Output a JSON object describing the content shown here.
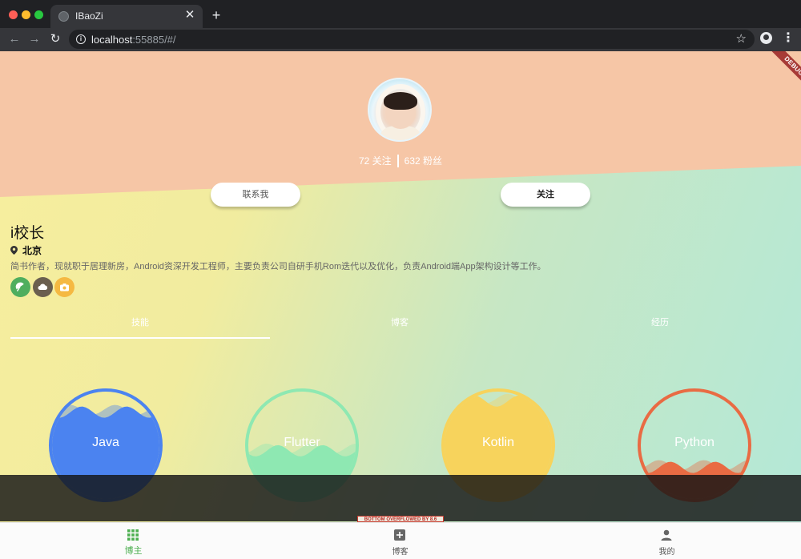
{
  "browser": {
    "tab_title": "IBaoZi",
    "tab_close": "✕",
    "new_tab": "+",
    "url_host": "localhost",
    "url_rest": ":55885/#/",
    "icons": [
      "back-icon",
      "forward-icon",
      "reload-icon",
      "info-icon",
      "star-icon",
      "profile-icon",
      "menu-icon"
    ]
  },
  "app": {
    "debug_banner": "DEBUG",
    "profile": {
      "following": "72 关注",
      "followers": "632 粉丝",
      "contact_button": "联系我",
      "follow_button": "关注",
      "name": "i校长",
      "location": "北京",
      "bio": "简书作者，现就职于居理新房，Android资深开发工程师，主要负责公司自研手机Rom迭代以及优化，负责Android端App架构设计等工作。"
    },
    "social_links": [
      {
        "icon": "umbrella-icon",
        "color": "#4fae5e"
      },
      {
        "icon": "cloud-icon",
        "color": "#6a5f4f"
      },
      {
        "icon": "camera-icon",
        "color": "#f5b942"
      }
    ],
    "tabs": [
      "技能",
      "博客",
      "经历"
    ],
    "active_tab": 0,
    "skills": [
      {
        "name": "Java",
        "color": "#4b83f0",
        "level": 0.8
      },
      {
        "name": "Flutter",
        "color": "#8ee8b2",
        "level": 0.45
      },
      {
        "name": "Kotlin",
        "color": "#f7d35c",
        "level": 0.9
      },
      {
        "name": "Python",
        "color": "#e96b43",
        "level": 0.3
      }
    ],
    "overflow_warning": "BOTTOM OVERFLOWED BY 8.6 PIXELS",
    "bottom_nav": [
      {
        "label": "博主",
        "icon": "grid-icon",
        "active": true
      },
      {
        "label": "博客",
        "icon": "add-box-icon",
        "active": false
      },
      {
        "label": "我的",
        "icon": "person-icon",
        "active": false
      }
    ],
    "colors": {
      "header": "#f6c6a6",
      "active_nav": "#4caf50"
    }
  }
}
